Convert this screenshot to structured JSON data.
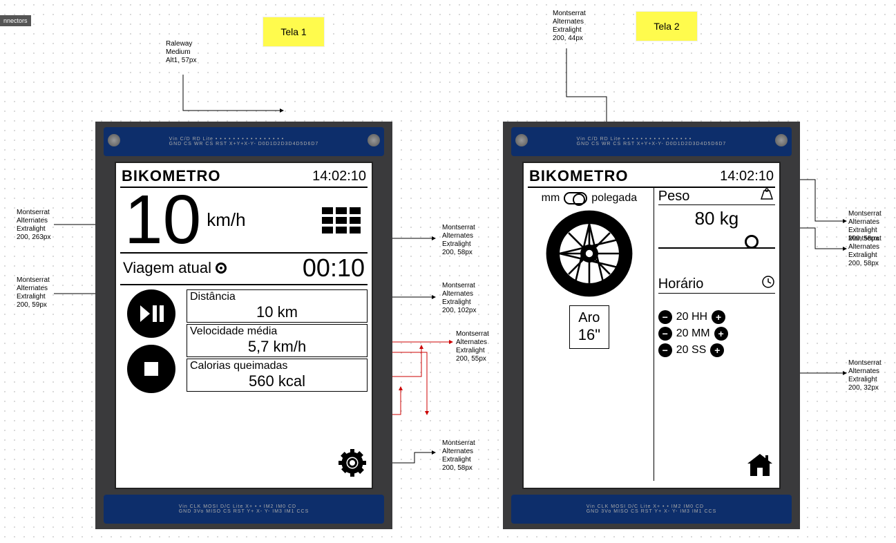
{
  "canvas": {
    "toolbar_tab": "nnectors",
    "sticky1": "Tela 1",
    "sticky2": "Tela 2"
  },
  "device1": {
    "logo": "BIKOMETRO",
    "clock": "14:02:10",
    "speed_value": "10",
    "speed_unit": "km/h",
    "trip_label": "Viagem atual",
    "trip_timer": "00:10",
    "stats": {
      "dist_label": "Distância",
      "dist_value": "10 km",
      "avg_label": "Velocidade média",
      "avg_value": "5,7 km/h",
      "cal_label": "Calorias queimadas",
      "cal_value": "560 kcal"
    }
  },
  "device2": {
    "logo": "BIKOMETRO",
    "clock": "14:02:10",
    "unit_mm": "mm",
    "unit_in": "polegada",
    "aro_label": "Aro",
    "aro_value": "16\"",
    "peso_label": "Peso",
    "peso_value": "80 kg",
    "horario_label": "Horário",
    "hh": "20 HH",
    "mm": "20 MM",
    "ss": "20 SS"
  },
  "annotations": {
    "a1": "Raleway\nMedium\nAlt1, 57px",
    "a2": "Montserrat\nAlternates\nExtralight\n200, 263px",
    "a3": "Montserrat\nAlternates\nExtralight\n200, 59px",
    "a4": "Montserrat\nAlternates\nExtralight\n200, 58px",
    "a5": "Montserrat\nAlternates\nExtralight\n200, 102px",
    "a6": "Montserrat\nAlternates\nExtralight\n200, 55px",
    "a7": "Montserrat\nAlternates\nExtralight\n200, 58px",
    "a8": "Montserrat\nAlternates\nExtralight\n200, 44px",
    "a9": "Montserrat\nAlternates\nExtralight\n200, 58px",
    "a10": "Montserrat\nAlternates\nExtralight\n200, 32px",
    "a11": "Montserrat\nAlternates\nExtralight\n200, 58px"
  }
}
